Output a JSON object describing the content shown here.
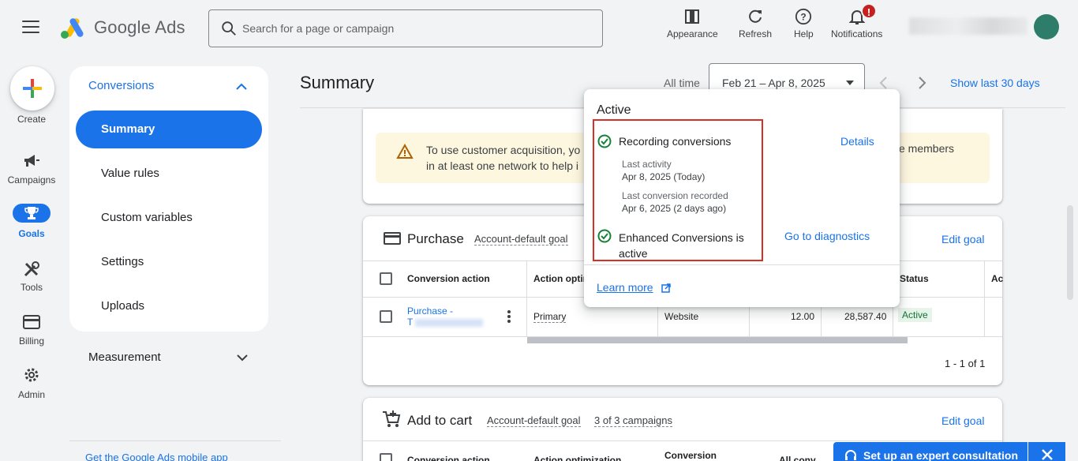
{
  "header": {
    "logo_text": "Google Ads",
    "search_placeholder": "Search for a page or campaign",
    "tools": [
      {
        "label": "Appearance",
        "icon": "appearance-icon"
      },
      {
        "label": "Refresh",
        "icon": "refresh-icon"
      },
      {
        "label": "Help",
        "icon": "help-icon"
      },
      {
        "label": "Notifications",
        "icon": "bell-icon",
        "badge": "!"
      }
    ]
  },
  "rail": {
    "create": "Create",
    "items": [
      {
        "label": "Campaigns",
        "icon": "megaphone-icon"
      },
      {
        "label": "Goals",
        "icon": "trophy-icon",
        "active": true
      },
      {
        "label": "Tools",
        "icon": "tools-icon"
      },
      {
        "label": "Billing",
        "icon": "card-icon"
      },
      {
        "label": "Admin",
        "icon": "gear-icon"
      }
    ]
  },
  "sidenav": {
    "section": "Conversions",
    "items": [
      "Summary",
      "Value rules",
      "Custom variables",
      "Settings",
      "Uploads"
    ],
    "active": "Summary",
    "measurement": "Measurement",
    "mobile_app": "Get the Google Ads mobile app"
  },
  "main": {
    "title": "Summary",
    "all_time": "All time",
    "date_range": "Feb 21 – Apr 8, 2025",
    "show_last": "Show last 30 days",
    "warning_line1": "To use customer acquisition, yo",
    "warning_line1_end": "ve members",
    "warning_line2": "in at least one network to help i"
  },
  "purchase": {
    "title": "Purchase",
    "goal": "Account-default goal",
    "edit": "Edit goal",
    "headers": {
      "action": "Conversion action",
      "optim": "Action optim",
      "status": "Status",
      "ac": "Ac"
    },
    "row": {
      "name": "Purchase -",
      "name2": "T",
      "optimization": "Primary",
      "source": "Website",
      "value1": "12.00",
      "value2": "28,587.40",
      "status": "Active"
    },
    "pagination": "1 - 1 of 1"
  },
  "add_to_cart": {
    "title": "Add to cart",
    "goal": "Account-default goal",
    "campaigns": "3 of 3 campaigns",
    "edit": "Edit goal",
    "headers": {
      "action": "Conversion action",
      "optimization": "Action optimization",
      "source": "Conversion",
      "allconv": "All conv"
    }
  },
  "popover": {
    "title": "Active",
    "recording": "Recording conversions",
    "details": "Details",
    "last_activity_label": "Last activity",
    "last_activity_value": "Apr 8, 2025 (Today)",
    "last_conv_label": "Last conversion recorded",
    "last_conv_value": "Apr 6, 2025 (2 days ago)",
    "enhanced": "Enhanced Conversions is active",
    "diagnostics": "Go to diagnostics",
    "learn_more": "Learn more"
  },
  "expert_banner": "Set up an expert consultation",
  "colors": {
    "primary": "#1a73e8",
    "success": "#188038",
    "highlight": "#d93025",
    "warning_bg": "#fef7e0"
  }
}
